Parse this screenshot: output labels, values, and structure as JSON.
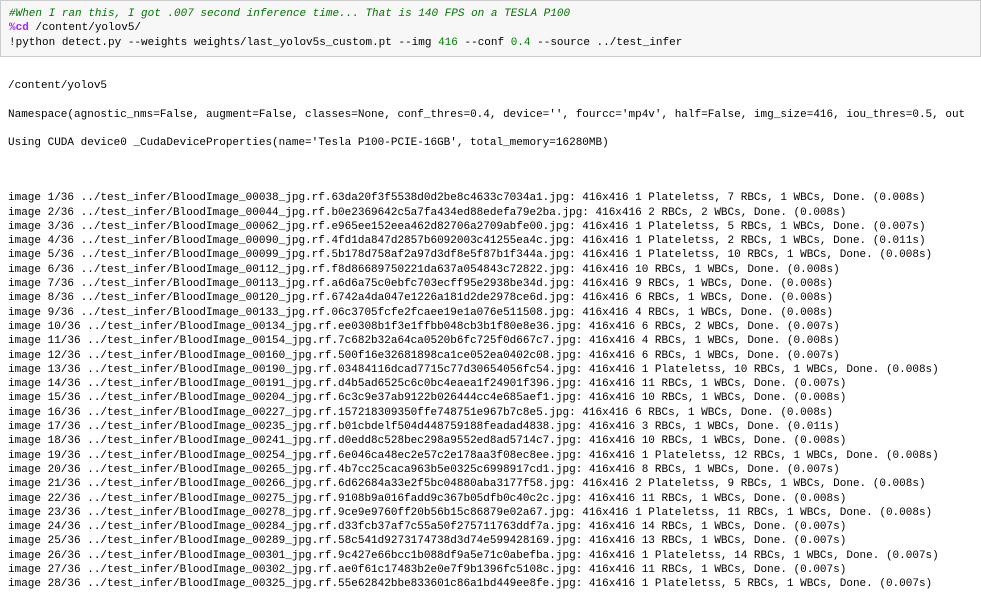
{
  "input": {
    "comment": "#When I ran this, I got .007 second inference time... That is 140 FPS on a TESLA P100",
    "magic_cmd": "%cd",
    "magic_arg": " /content/yolov5/",
    "bang": "!",
    "cmd_pre": "python detect.py --weights weights/last_yolov5s_custom.pt --img ",
    "img_size": "416",
    "cmd_mid": " --conf ",
    "conf": "0.4",
    "cmd_post": " --source ../test_infer"
  },
  "output": {
    "cwd": "/content/yolov5",
    "namespace": "Namespace(agnostic_nms=False, augment=False, classes=None, conf_thres=0.4, device='', fourcc='mp4v', half=False, img_size=416, iou_thres=0.5, out",
    "cuda": "Using CUDA device0 _CudaDeviceProperties(name='Tesla P100-PCIE-16GB', total_memory=16280MB)",
    "lines": [
      "image 1/36 ../test_infer/BloodImage_00038_jpg.rf.63da20f3f5538d0d2be8c4633c7034a1.jpg: 416x416 1 Plateletss, 7 RBCs, 1 WBCs, Done. (0.008s)",
      "image 2/36 ../test_infer/BloodImage_00044_jpg.rf.b0e2369642c5a7fa434ed88edefa79e2ba.jpg: 416x416 2 RBCs, 2 WBCs, Done. (0.008s)",
      "image 3/36 ../test_infer/BloodImage_00062_jpg.rf.e965ee152eea462d82706a2709abfe00.jpg: 416x416 1 Plateletss, 5 RBCs, 1 WBCs, Done. (0.007s)",
      "image 4/36 ../test_infer/BloodImage_00090_jpg.rf.4fd1da847d2857b6092003c41255ea4c.jpg: 416x416 1 Plateletss, 2 RBCs, 1 WBCs, Done. (0.011s)",
      "image 5/36 ../test_infer/BloodImage_00099_jpg.rf.5b178d758af2a97d3df8e5f87b1f344a.jpg: 416x416 1 Plateletss, 10 RBCs, 1 WBCs, Done. (0.008s)",
      "image 6/36 ../test_infer/BloodImage_00112_jpg.rf.f8d86689750221da637a054843c72822.jpg: 416x416 10 RBCs, 1 WBCs, Done. (0.008s)",
      "image 7/36 ../test_infer/BloodImage_00113_jpg.rf.a6d6a75c0ebfc703ecff95e2938be34d.jpg: 416x416 9 RBCs, 1 WBCs, Done. (0.008s)",
      "image 8/36 ../test_infer/BloodImage_00120_jpg.rf.6742a4da047e1226a181d2de2978ce6d.jpg: 416x416 6 RBCs, 1 WBCs, Done. (0.008s)",
      "image 9/36 ../test_infer/BloodImage_00133_jpg.rf.06c3705fcfe2fcaee19e1a076e511508.jpg: 416x416 4 RBCs, 1 WBCs, Done. (0.008s)",
      "image 10/36 ../test_infer/BloodImage_00134_jpg.rf.ee0308b1f3e1ffbb048cb3b1f80e8e36.jpg: 416x416 6 RBCs, 2 WBCs, Done. (0.007s)",
      "image 11/36 ../test_infer/BloodImage_00154_jpg.rf.7c682b32a64ca0520b6fc725f0d667c7.jpg: 416x416 4 RBCs, 1 WBCs, Done. (0.008s)",
      "image 12/36 ../test_infer/BloodImage_00160_jpg.rf.500f16e32681898ca1ce052ea0402c08.jpg: 416x416 6 RBCs, 1 WBCs, Done. (0.007s)",
      "image 13/36 ../test_infer/BloodImage_00190_jpg.rf.03484116dcad7715c77d30654056fc54.jpg: 416x416 1 Plateletss, 10 RBCs, 1 WBCs, Done. (0.008s)",
      "image 14/36 ../test_infer/BloodImage_00191_jpg.rf.d4b5ad6525c6c0bc4eaea1f24901f396.jpg: 416x416 11 RBCs, 1 WBCs, Done. (0.007s)",
      "image 15/36 ../test_infer/BloodImage_00204_jpg.rf.6c3c9e37ab9122b026444cc4e685aef1.jpg: 416x416 10 RBCs, 1 WBCs, Done. (0.008s)",
      "image 16/36 ../test_infer/BloodImage_00227_jpg.rf.157218309350ffe748751e967b7c8e5.jpg: 416x416 6 RBCs, 1 WBCs, Done. (0.008s)",
      "image 17/36 ../test_infer/BloodImage_00235_jpg.rf.b01cbdelf504d448759188feadad4838.jpg: 416x416 3 RBCs, 1 WBCs, Done. (0.011s)",
      "image 18/36 ../test_infer/BloodImage_00241_jpg.rf.d0edd8c528bec298a9552ed8ad5714c7.jpg: 416x416 10 RBCs, 1 WBCs, Done. (0.008s)",
      "image 19/36 ../test_infer/BloodImage_00254_jpg.rf.6e046ca48ec2e57c2e178aa3f08ec8ee.jpg: 416x416 1 Plateletss, 12 RBCs, 1 WBCs, Done. (0.008s)",
      "image 20/36 ../test_infer/BloodImage_00265_jpg.rf.4b7cc25caca963b5e0325c6998917cd1.jpg: 416x416 8 RBCs, 1 WBCs, Done. (0.007s)",
      "image 21/36 ../test_infer/BloodImage_00266_jpg.rf.6d62684a33e2f5bc04880aba3177f58.jpg: 416x416 2 Plateletss, 9 RBCs, 1 WBCs, Done. (0.008s)",
      "image 22/36 ../test_infer/BloodImage_00275_jpg.rf.9108b9a016fadd9c367b05dfb0c40c2c.jpg: 416x416 11 RBCs, 1 WBCs, Done. (0.008s)",
      "image 23/36 ../test_infer/BloodImage_00278_jpg.rf.9ce9e9760ff20b56b15c86879e02a67.jpg: 416x416 1 Plateletss, 11 RBCs, 1 WBCs, Done. (0.008s)",
      "image 24/36 ../test_infer/BloodImage_00284_jpg.rf.d33fcb37af7c55a50f275711763ddf7a.jpg: 416x416 14 RBCs, 1 WBCs, Done. (0.007s)",
      "image 25/36 ../test_infer/BloodImage_00289_jpg.rf.58c541d9273174738d3d74e599428169.jpg: 416x416 13 RBCs, 1 WBCs, Done. (0.007s)",
      "image 26/36 ../test_infer/BloodImage_00301_jpg.rf.9c427e66bcc1b088df9a5e71c0abefba.jpg: 416x416 1 Plateletss, 14 RBCs, 1 WBCs, Done. (0.007s)",
      "image 27/36 ../test_infer/BloodImage_00302_jpg.rf.ae0f61c17483b2e0e7f9b1396fc5108c.jpg: 416x416 11 RBCs, 1 WBCs, Done. (0.007s)",
      "image 28/36 ../test_infer/BloodImage_00325_jpg.rf.55e62842bbe833601c86a1bd449ee8fe.jpg: 416x416 1 Plateletss, 5 RBCs, 1 WBCs, Done. (0.007s)"
    ]
  }
}
